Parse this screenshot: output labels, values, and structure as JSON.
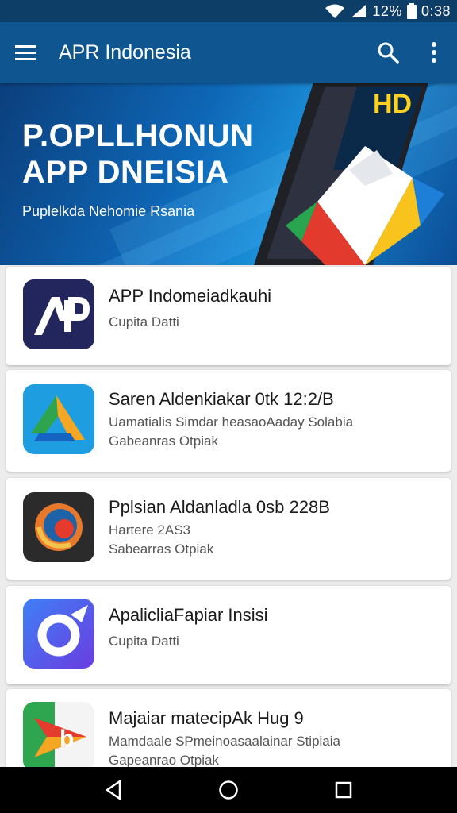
{
  "status_bar": {
    "battery_percent": "12%",
    "time": "0:38",
    "icons": [
      "wifi-icon",
      "signal-icon",
      "battery-icon"
    ]
  },
  "app_bar": {
    "title": "APR Indonesia",
    "icons": [
      "menu-icon",
      "search-icon",
      "more-vert-icon"
    ]
  },
  "banner": {
    "line1": "P.OPLLHONUN",
    "line2": "APP DNEISIA",
    "subtitle": "Puplelkda Nehomie Rsania"
  },
  "apps": [
    {
      "name": "APP Indomeiadkauhi",
      "line1": "Cupita Datti",
      "line2": "",
      "icon": "app-logo-ap-icon"
    },
    {
      "name": "Saren Aldenkiakar 0tk 12:2/B",
      "line1": "Uamatialis Simdar heasaoAaday Solabia",
      "line2": "Gabeanras Otpiak",
      "icon": "app-logo-triangle-icon"
    },
    {
      "name": "Pplsian Aldanladla 0sb 228B",
      "line1": "Hartere 2AS3",
      "line2": "Sabearras Otpiak",
      "icon": "app-logo-swirl-icon"
    },
    {
      "name": "ApalicliaFapiar Insisi",
      "line1": "Cupita Datti",
      "line2": "",
      "icon": "app-logo-ring-icon"
    },
    {
      "name": "Majaiar matecipAk Hug 9",
      "line1": "Mamdaale SPmeinoasaalainar Stipiaia",
      "line2": "Gapeanrao Otpiak",
      "icon": "app-logo-arrow-icon"
    }
  ],
  "nav_bar": {
    "icons": [
      "back-icon",
      "home-icon",
      "recents-icon"
    ]
  },
  "colors": {
    "status_bar": "#0d3e68",
    "app_bar": "#0f5690",
    "background": "#ececec"
  }
}
